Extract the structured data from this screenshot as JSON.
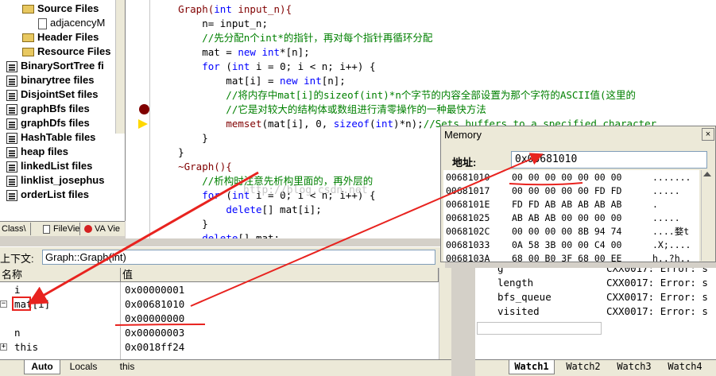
{
  "tree": {
    "items": [
      {
        "label": "Source Files",
        "kind": "folder",
        "indent": 1
      },
      {
        "label": "adjacencyM",
        "kind": "doc",
        "indent": 2
      },
      {
        "label": "Header Files",
        "kind": "folder",
        "indent": 1
      },
      {
        "label": "Resource Files",
        "kind": "folder",
        "indent": 1
      },
      {
        "label": "BinarySortTree fi",
        "kind": "project",
        "indent": 0
      },
      {
        "label": "binarytree files",
        "kind": "project",
        "indent": 0
      },
      {
        "label": "DisjointSet files",
        "kind": "project",
        "indent": 0
      },
      {
        "label": "graphBfs files",
        "kind": "project",
        "indent": 0
      },
      {
        "label": "graphDfs files",
        "kind": "project",
        "indent": 0
      },
      {
        "label": "HashTable files",
        "kind": "project",
        "indent": 0
      },
      {
        "label": "heap files",
        "kind": "project",
        "indent": 0
      },
      {
        "label": "linkedList files",
        "kind": "project",
        "indent": 0
      },
      {
        "label": "linklist_josephus",
        "kind": "project",
        "indent": 0
      },
      {
        "label": "orderList files",
        "kind": "project",
        "indent": 0
      }
    ],
    "tabs": [
      "Class\\",
      "FileVie",
      "VA Vie"
    ]
  },
  "code": {
    "lines": [
      [
        {
          "t": "    Graph(",
          "c": "fn"
        },
        {
          "t": "int",
          "c": "kw"
        },
        {
          "t": " input_n){",
          "c": "fn"
        }
      ],
      [
        {
          "t": "        n= input_n;",
          "c": ""
        }
      ],
      [
        {
          "t": "        //先分配n个int*的指针，再对每个指针再循环分配",
          "c": "cm"
        }
      ],
      [
        {
          "t": "        mat = ",
          "c": ""
        },
        {
          "t": "new",
          "c": "kw"
        },
        {
          "t": " ",
          "c": ""
        },
        {
          "t": "int",
          "c": "kw"
        },
        {
          "t": "*[n];",
          "c": ""
        }
      ],
      [
        {
          "t": "        ",
          "c": ""
        },
        {
          "t": "for",
          "c": "kw"
        },
        {
          "t": " (",
          "c": ""
        },
        {
          "t": "int",
          "c": "kw"
        },
        {
          "t": " i = 0; i < n; i++) {",
          "c": ""
        }
      ],
      [
        {
          "t": "            mat[i] = ",
          "c": ""
        },
        {
          "t": "new",
          "c": "kw"
        },
        {
          "t": " ",
          "c": ""
        },
        {
          "t": "int",
          "c": "kw"
        },
        {
          "t": "[n];",
          "c": ""
        }
      ],
      [
        {
          "t": "            //将内存中mat[i]的sizeof(int)*n个字节的内容全部设置为那个字符的ASCII值(这里的",
          "c": "cm"
        }
      ],
      [
        {
          "t": "            //它是对较大的结构体或数组进行清零操作的一种最快方法",
          "c": "cm"
        }
      ],
      [
        {
          "t": "            ",
          "c": ""
        },
        {
          "t": "memset",
          "c": "fn"
        },
        {
          "t": "(mat[i], 0, ",
          "c": ""
        },
        {
          "t": "sizeof",
          "c": "kw"
        },
        {
          "t": "(",
          "c": ""
        },
        {
          "t": "int",
          "c": "kw"
        },
        {
          "t": ")*n);",
          "c": ""
        },
        {
          "t": "//Sets buffers to a specified character.",
          "c": "cm"
        }
      ],
      [
        {
          "t": "        }",
          "c": ""
        }
      ],
      [
        {
          "t": "    }",
          "c": ""
        }
      ],
      [
        {
          "t": "    ~Graph(){",
          "c": "fn"
        }
      ],
      [
        {
          "t": "        //析构时注意先析构里面的，再外层的",
          "c": "cm"
        }
      ],
      [
        {
          "t": "        ",
          "c": ""
        },
        {
          "t": "for",
          "c": "kw"
        },
        {
          "t": " (",
          "c": ""
        },
        {
          "t": "int",
          "c": "kw"
        },
        {
          "t": " i = 0; i < n; i++) {",
          "c": ""
        }
      ],
      [
        {
          "t": "            ",
          "c": ""
        },
        {
          "t": "delete",
          "c": "kw"
        },
        {
          "t": "[] mat[i];",
          "c": ""
        }
      ],
      [
        {
          "t": "        }",
          "c": ""
        }
      ],
      [
        {
          "t": "        ",
          "c": ""
        },
        {
          "t": "delete",
          "c": "kw"
        },
        {
          "t": "[] mat;",
          "c": ""
        }
      ],
      [
        {
          "t": "    }",
          "c": ""
        }
      ]
    ],
    "watermark": "http://blog.csdn.net"
  },
  "context": {
    "label": "上下文:",
    "value": "Graph::Graph(int)"
  },
  "locals": {
    "col_name": "名称",
    "col_value": "值",
    "rows": [
      {
        "name": "i",
        "value": "0x00000001",
        "expander": ""
      },
      {
        "name": "mat[i]",
        "value": "0x00681010",
        "expander": "−"
      },
      {
        "name": "",
        "value": "0x00000000",
        "expander": ""
      },
      {
        "name": "n",
        "value": "0x00000003",
        "expander": ""
      },
      {
        "name": "this",
        "value": "0x0018ff24",
        "expander": "+"
      }
    ],
    "tabs": [
      "Auto",
      "Locals",
      "this"
    ]
  },
  "watch": {
    "rows": [
      {
        "name": "g",
        "value": "CXX0017: Error: s"
      },
      {
        "name": "length",
        "value": "CXX0017: Error: s"
      },
      {
        "name": "bfs_queue",
        "value": "CXX0017: Error: s"
      },
      {
        "name": "visited",
        "value": "CXX0017: Error: s"
      }
    ],
    "tabs": [
      "Watch1",
      "Watch2",
      "Watch3",
      "Watch4"
    ]
  },
  "memory": {
    "title": "Memory",
    "close": "×",
    "addr_label": "地址:",
    "addr_value": "0x00681010",
    "rows": [
      {
        "addr": "00681010",
        "bytes": "00 00 00 00 00 00 00",
        "ascii": "......."
      },
      {
        "addr": "00681017",
        "bytes": "00 00 00 00 00 FD FD",
        "ascii": "....."
      },
      {
        "addr": "0068101E",
        "bytes": "FD FD AB AB AB AB AB",
        "ascii": "."
      },
      {
        "addr": "00681025",
        "bytes": "AB AB AB 00 00 00 00",
        "ascii": "....."
      },
      {
        "addr": "0068102C",
        "bytes": "00 00 00 00 8B 94 74",
        "ascii": "....婺t"
      },
      {
        "addr": "00681033",
        "bytes": "0A 58 3B 00 00 C4 00",
        "ascii": ".X;...."
      },
      {
        "addr": "0068103A",
        "bytes": "68 00 B0 3F 68 00 EE",
        "ascii": "h..?h.."
      }
    ]
  },
  "colors": {
    "annotation": "#e8231f",
    "keyword": "#0000ff",
    "comment": "#008000",
    "function": "#800000"
  }
}
